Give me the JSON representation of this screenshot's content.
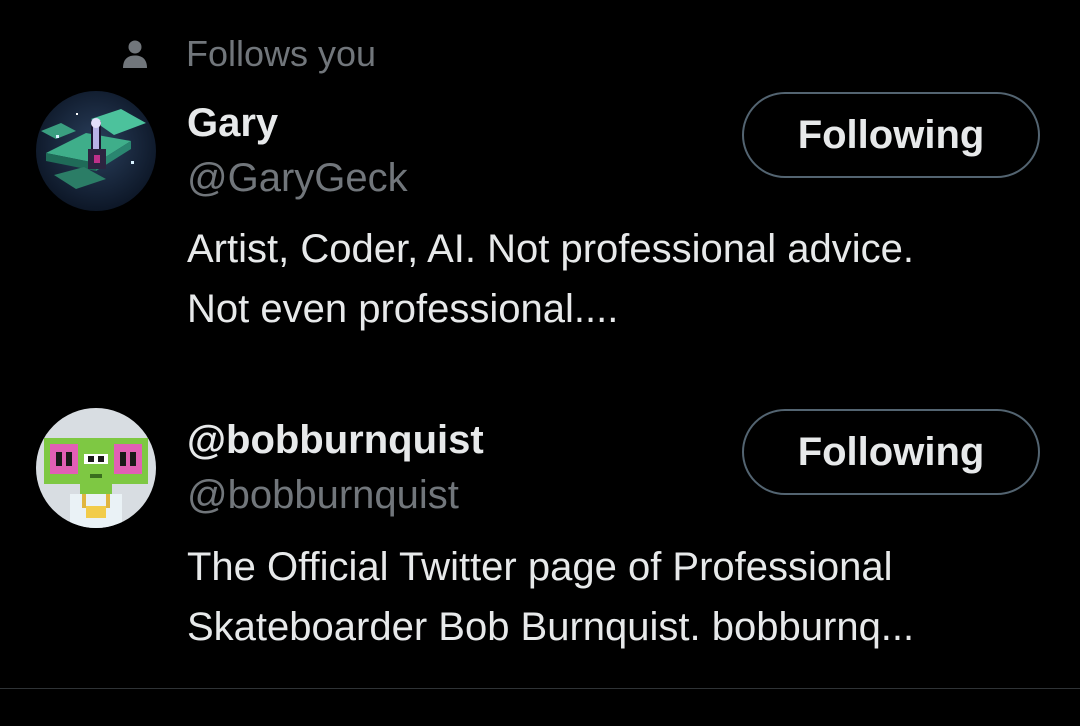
{
  "social_context": {
    "icon": "person-icon",
    "text": "Follows you"
  },
  "users": [
    {
      "name": "Gary",
      "handle": "@GaryGeck",
      "bio_lines": [
        "Artist, Coder, AI. Not professional advice.",
        "Not even professional...."
      ],
      "button_label": "Following",
      "avatar": "gary-avatar"
    },
    {
      "name": "@bobburnquist",
      "handle": "@bobburnquist",
      "bio_lines": [
        "The Official Twitter page of Professional",
        "Skateboarder Bob Burnquist. bobburnq..."
      ],
      "button_label": "Following",
      "avatar": "bob-avatar"
    }
  ],
  "colors": {
    "background": "#000000",
    "primary_text": "#e7e9ea",
    "secondary_text": "#71767b",
    "button_border": "#536471"
  }
}
